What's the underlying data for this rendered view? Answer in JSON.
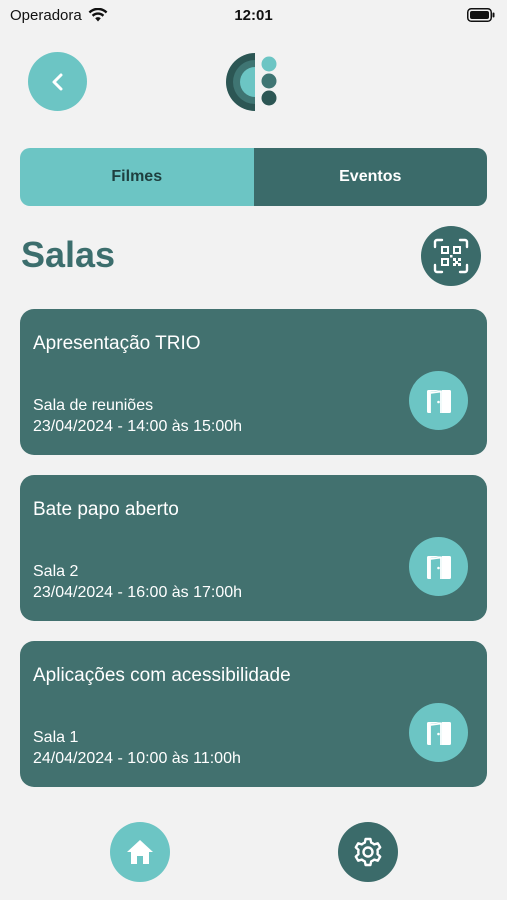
{
  "status_bar": {
    "carrier": "Operadora",
    "time": "12:01",
    "icons": [
      "wifi-icon",
      "battery-icon"
    ]
  },
  "header": {
    "back_icon": "chevron-left-icon",
    "logo": "app-logo"
  },
  "tabs": [
    {
      "label": "Filmes",
      "active": true
    },
    {
      "label": "Eventos",
      "active": false
    }
  ],
  "page": {
    "title": "Salas",
    "qr_icon": "qr-code-icon"
  },
  "rooms": [
    {
      "title": "Apresentação TRIO",
      "room": "Sala de reuniões",
      "datetime": "23/04/2024 - 14:00 às 15:00h",
      "icon": "door-icon"
    },
    {
      "title": "Bate papo aberto",
      "room": "Sala 2",
      "datetime": "23/04/2024 - 16:00 às 17:00h",
      "icon": "door-icon"
    },
    {
      "title": "Aplicações com acessibilidade",
      "room": "Sala 1",
      "datetime": "24/04/2024 - 10:00 às 11:00h",
      "icon": "door-icon"
    }
  ],
  "bottom_nav": {
    "items": [
      {
        "icon": "home-icon",
        "active": true
      },
      {
        "icon": "gear-icon",
        "active": false
      }
    ]
  },
  "colors": {
    "teal_light": "#6cc5c4",
    "teal_dark": "#3b6b6a",
    "card": "#42716f",
    "background": "#f2f2f2"
  }
}
